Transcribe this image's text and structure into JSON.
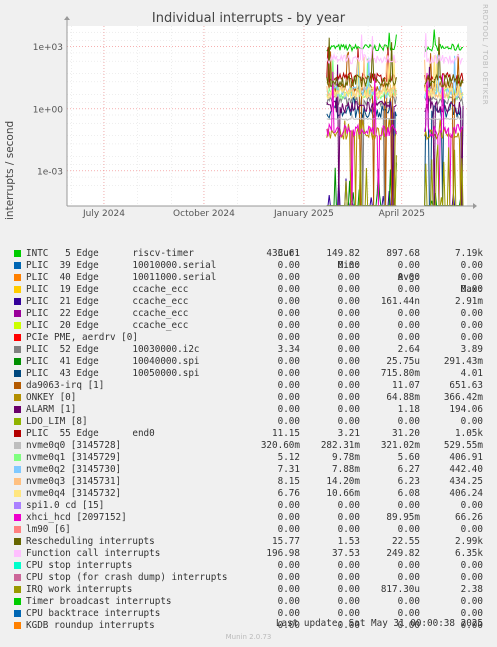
{
  "title": "Individual interrupts - by year",
  "watermark": "RRDTOOL / TOBI OETIKER",
  "footer": {
    "last_update": "Last update: Sat May 31 00:00:38 2025",
    "munin": "Munin 2.0.73"
  },
  "colors": {
    "background": "#f0f0f0",
    "plot": "#ffffff",
    "grid_major": "#f08080",
    "grid_minor": "#dddddd"
  },
  "legend_headers": {
    "cur": "Cur:",
    "min": "Min:",
    "avg": "Avg:",
    "max": "Max:"
  },
  "chart_data": {
    "type": "line",
    "title": "Individual interrupts - by year",
    "ylabel": "interrupts / second",
    "yscale": "log",
    "ylim": [
      2e-05,
      10000
    ],
    "yticks": [
      "1e+03",
      "1e+00",
      "1e-03"
    ],
    "xlim": [
      "2024-05-28",
      "2025-05-31"
    ],
    "xticks": [
      {
        "label": "July 2024",
        "date": "2024-07-01"
      },
      {
        "label": "October 2024",
        "date": "2024-10-01"
      },
      {
        "label": "January 2025",
        "date": "2025-01-01"
      },
      {
        "label": "April 2025",
        "date": "2025-04-01"
      }
    ],
    "data_periods": [
      [
        "2025-01-22",
        "2025-03-28"
      ],
      [
        "2025-04-22",
        "2025-05-28"
      ]
    ],
    "grid": true,
    "series": [
      {
        "name": "INTC   5 Edge      riscv-timer",
        "color": "#00cc00",
        "cur": "433.61",
        "min": "149.82",
        "avg": "897.68",
        "max": "7.19k"
      },
      {
        "name": "PLIC  39 Edge      10010000.serial",
        "color": "#0066b3",
        "cur": "0.00",
        "min": "0.00",
        "avg": "0.00",
        "max": "0.00"
      },
      {
        "name": "PLIC  40 Edge      10011000.serial",
        "color": "#ff8000",
        "cur": "0.00",
        "min": "0.00",
        "avg": "0.00",
        "max": "0.00"
      },
      {
        "name": "PLIC  19 Edge      ccache_ecc",
        "color": "#ffcc00",
        "cur": "0.00",
        "min": "0.00",
        "avg": "0.00",
        "max": "0.00"
      },
      {
        "name": "PLIC  21 Edge      ccache_ecc",
        "color": "#330099",
        "cur": "0.00",
        "min": "0.00",
        "avg": "161.44n",
        "max": "2.91m"
      },
      {
        "name": "PLIC  22 Edge      ccache_ecc",
        "color": "#990099",
        "cur": "0.00",
        "min": "0.00",
        "avg": "0.00",
        "max": "0.00"
      },
      {
        "name": "PLIC  20 Edge      ccache_ecc",
        "color": "#ccff00",
        "cur": "0.00",
        "min": "0.00",
        "avg": "0.00",
        "max": "0.00"
      },
      {
        "name": "PCIe PME, aerdrv [0]",
        "color": "#ff0000",
        "cur": "0.00",
        "min": "0.00",
        "avg": "0.00",
        "max": "0.00"
      },
      {
        "name": "PLIC  52 Edge      10030000.i2c",
        "color": "#808080",
        "cur": "3.34",
        "min": "0.00",
        "avg": "2.64",
        "max": "3.89"
      },
      {
        "name": "PLIC  41 Edge      10040000.spi",
        "color": "#008f00",
        "cur": "0.00",
        "min": "0.00",
        "avg": "25.75u",
        "max": "291.43m"
      },
      {
        "name": "PLIC  43 Edge      10050000.spi",
        "color": "#00487d",
        "cur": "0.00",
        "min": "0.00",
        "avg": "715.80m",
        "max": "4.01"
      },
      {
        "name": "da9063-irq [1]",
        "color": "#b35a00",
        "cur": "0.00",
        "min": "0.00",
        "avg": "11.07",
        "max": "651.63"
      },
      {
        "name": "ONKEY [0]",
        "color": "#b38f00",
        "cur": "0.00",
        "min": "0.00",
        "avg": "64.88m",
        "max": "366.42m"
      },
      {
        "name": "ALARM [1]",
        "color": "#6b006b",
        "cur": "0.00",
        "min": "0.00",
        "avg": "1.18",
        "max": "194.06"
      },
      {
        "name": "LDO_LIM [8]",
        "color": "#8fb300",
        "cur": "0.00",
        "min": "0.00",
        "avg": "0.00",
        "max": "0.00"
      },
      {
        "name": "PLIC  55 Edge      end0",
        "color": "#b30000",
        "cur": "11.15",
        "min": "3.21",
        "avg": "31.20",
        "max": "1.05k"
      },
      {
        "name": "nvme0q0 [3145728]",
        "color": "#bebebe",
        "cur": "320.60m",
        "min": "282.31m",
        "avg": "321.02m",
        "max": "529.55m"
      },
      {
        "name": "nvme0q1 [3145729]",
        "color": "#80ff80",
        "cur": "5.12",
        "min": "9.78m",
        "avg": "5.60",
        "max": "406.91"
      },
      {
        "name": "nvme0q2 [3145730]",
        "color": "#80c9ff",
        "cur": "7.31",
        "min": "7.88m",
        "avg": "6.27",
        "max": "442.40"
      },
      {
        "name": "nvme0q3 [3145731]",
        "color": "#ffc080",
        "cur": "8.15",
        "min": "14.20m",
        "avg": "6.23",
        "max": "434.25"
      },
      {
        "name": "nvme0q4 [3145732]",
        "color": "#ffe680",
        "cur": "6.76",
        "min": "10.66m",
        "avg": "6.08",
        "max": "406.24"
      },
      {
        "name": "spi1.0 cd [15]",
        "color": "#aa80ff",
        "cur": "0.00",
        "min": "0.00",
        "avg": "0.00",
        "max": "0.00"
      },
      {
        "name": "xhci_hcd [2097152]",
        "color": "#ee00cc",
        "cur": "0.00",
        "min": "0.00",
        "avg": "89.95m",
        "max": "66.26"
      },
      {
        "name": "lm90 [6]",
        "color": "#ff8080",
        "cur": "0.00",
        "min": "0.00",
        "avg": "0.00",
        "max": "0.00"
      },
      {
        "name": "Rescheduling interrupts",
        "color": "#666600",
        "cur": "15.77",
        "min": "1.53",
        "avg": "22.55",
        "max": "2.99k"
      },
      {
        "name": "Function call interrupts",
        "color": "#ffbfff",
        "cur": "196.98",
        "min": "37.53",
        "avg": "249.82",
        "max": "6.35k"
      },
      {
        "name": "CPU stop interrupts",
        "color": "#00ffcc",
        "cur": "0.00",
        "min": "0.00",
        "avg": "0.00",
        "max": "0.00"
      },
      {
        "name": "CPU stop (for crash dump) interrupts",
        "color": "#cc6699",
        "cur": "0.00",
        "min": "0.00",
        "avg": "0.00",
        "max": "0.00"
      },
      {
        "name": "IRQ work interrupts",
        "color": "#999900",
        "cur": "0.00",
        "min": "0.00",
        "avg": "817.30u",
        "max": "2.38"
      },
      {
        "name": "Timer broadcast interrupts",
        "color": "#00cc00",
        "cur": "0.00",
        "min": "0.00",
        "avg": "0.00",
        "max": "0.00"
      },
      {
        "name": "CPU backtrace interrupts",
        "color": "#0066b3",
        "cur": "0.00",
        "min": "0.00",
        "avg": "0.00",
        "max": "0.00"
      },
      {
        "name": "KGDB roundup interrupts",
        "color": "#ff8000",
        "cur": "0.00",
        "min": "0.00",
        "avg": "0.00",
        "max": "0.00"
      }
    ]
  }
}
